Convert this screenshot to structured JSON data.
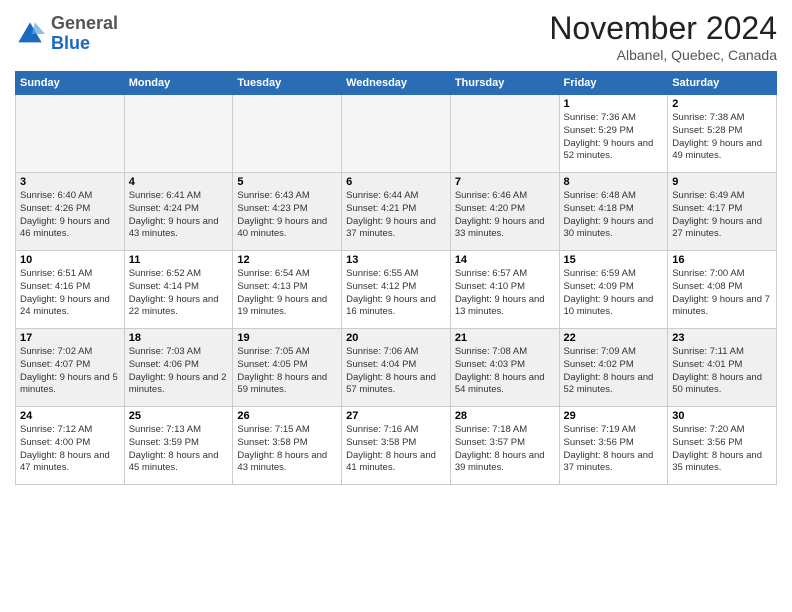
{
  "header": {
    "logo": {
      "general": "General",
      "blue": "Blue"
    },
    "title": "November 2024",
    "location": "Albanel, Quebec, Canada"
  },
  "calendar": {
    "headers": [
      "Sunday",
      "Monday",
      "Tuesday",
      "Wednesday",
      "Thursday",
      "Friday",
      "Saturday"
    ],
    "weeks": [
      [
        {
          "day": "",
          "info": ""
        },
        {
          "day": "",
          "info": ""
        },
        {
          "day": "",
          "info": ""
        },
        {
          "day": "",
          "info": ""
        },
        {
          "day": "",
          "info": ""
        },
        {
          "day": "1",
          "info": "Sunrise: 7:36 AM\nSunset: 5:29 PM\nDaylight: 9 hours and 52 minutes."
        },
        {
          "day": "2",
          "info": "Sunrise: 7:38 AM\nSunset: 5:28 PM\nDaylight: 9 hours and 49 minutes."
        }
      ],
      [
        {
          "day": "3",
          "info": "Sunrise: 6:40 AM\nSunset: 4:26 PM\nDaylight: 9 hours and 46 minutes."
        },
        {
          "day": "4",
          "info": "Sunrise: 6:41 AM\nSunset: 4:24 PM\nDaylight: 9 hours and 43 minutes."
        },
        {
          "day": "5",
          "info": "Sunrise: 6:43 AM\nSunset: 4:23 PM\nDaylight: 9 hours and 40 minutes."
        },
        {
          "day": "6",
          "info": "Sunrise: 6:44 AM\nSunset: 4:21 PM\nDaylight: 9 hours and 37 minutes."
        },
        {
          "day": "7",
          "info": "Sunrise: 6:46 AM\nSunset: 4:20 PM\nDaylight: 9 hours and 33 minutes."
        },
        {
          "day": "8",
          "info": "Sunrise: 6:48 AM\nSunset: 4:18 PM\nDaylight: 9 hours and 30 minutes."
        },
        {
          "day": "9",
          "info": "Sunrise: 6:49 AM\nSunset: 4:17 PM\nDaylight: 9 hours and 27 minutes."
        }
      ],
      [
        {
          "day": "10",
          "info": "Sunrise: 6:51 AM\nSunset: 4:16 PM\nDaylight: 9 hours and 24 minutes."
        },
        {
          "day": "11",
          "info": "Sunrise: 6:52 AM\nSunset: 4:14 PM\nDaylight: 9 hours and 22 minutes."
        },
        {
          "day": "12",
          "info": "Sunrise: 6:54 AM\nSunset: 4:13 PM\nDaylight: 9 hours and 19 minutes."
        },
        {
          "day": "13",
          "info": "Sunrise: 6:55 AM\nSunset: 4:12 PM\nDaylight: 9 hours and 16 minutes."
        },
        {
          "day": "14",
          "info": "Sunrise: 6:57 AM\nSunset: 4:10 PM\nDaylight: 9 hours and 13 minutes."
        },
        {
          "day": "15",
          "info": "Sunrise: 6:59 AM\nSunset: 4:09 PM\nDaylight: 9 hours and 10 minutes."
        },
        {
          "day": "16",
          "info": "Sunrise: 7:00 AM\nSunset: 4:08 PM\nDaylight: 9 hours and 7 minutes."
        }
      ],
      [
        {
          "day": "17",
          "info": "Sunrise: 7:02 AM\nSunset: 4:07 PM\nDaylight: 9 hours and 5 minutes."
        },
        {
          "day": "18",
          "info": "Sunrise: 7:03 AM\nSunset: 4:06 PM\nDaylight: 9 hours and 2 minutes."
        },
        {
          "day": "19",
          "info": "Sunrise: 7:05 AM\nSunset: 4:05 PM\nDaylight: 8 hours and 59 minutes."
        },
        {
          "day": "20",
          "info": "Sunrise: 7:06 AM\nSunset: 4:04 PM\nDaylight: 8 hours and 57 minutes."
        },
        {
          "day": "21",
          "info": "Sunrise: 7:08 AM\nSunset: 4:03 PM\nDaylight: 8 hours and 54 minutes."
        },
        {
          "day": "22",
          "info": "Sunrise: 7:09 AM\nSunset: 4:02 PM\nDaylight: 8 hours and 52 minutes."
        },
        {
          "day": "23",
          "info": "Sunrise: 7:11 AM\nSunset: 4:01 PM\nDaylight: 8 hours and 50 minutes."
        }
      ],
      [
        {
          "day": "24",
          "info": "Sunrise: 7:12 AM\nSunset: 4:00 PM\nDaylight: 8 hours and 47 minutes."
        },
        {
          "day": "25",
          "info": "Sunrise: 7:13 AM\nSunset: 3:59 PM\nDaylight: 8 hours and 45 minutes."
        },
        {
          "day": "26",
          "info": "Sunrise: 7:15 AM\nSunset: 3:58 PM\nDaylight: 8 hours and 43 minutes."
        },
        {
          "day": "27",
          "info": "Sunrise: 7:16 AM\nSunset: 3:58 PM\nDaylight: 8 hours and 41 minutes."
        },
        {
          "day": "28",
          "info": "Sunrise: 7:18 AM\nSunset: 3:57 PM\nDaylight: 8 hours and 39 minutes."
        },
        {
          "day": "29",
          "info": "Sunrise: 7:19 AM\nSunset: 3:56 PM\nDaylight: 8 hours and 37 minutes."
        },
        {
          "day": "30",
          "info": "Sunrise: 7:20 AM\nSunset: 3:56 PM\nDaylight: 8 hours and 35 minutes."
        }
      ]
    ]
  }
}
